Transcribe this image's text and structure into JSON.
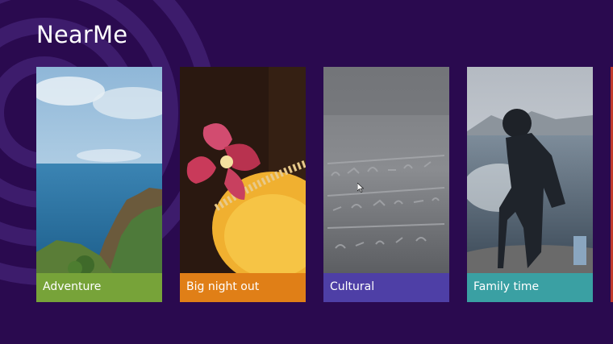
{
  "app": {
    "title": "NearMe"
  },
  "tiles": [
    {
      "label": "Adventure",
      "label_color": "#77a339"
    },
    {
      "label": "Big night out",
      "label_color": "#e07f17"
    },
    {
      "label": "Cultural",
      "label_color": "#4e3fa6"
    },
    {
      "label": "Family time",
      "label_color": "#3aa0a3"
    }
  ],
  "colors": {
    "background": "#2a0a4f",
    "rings": "#3d1c6c"
  }
}
